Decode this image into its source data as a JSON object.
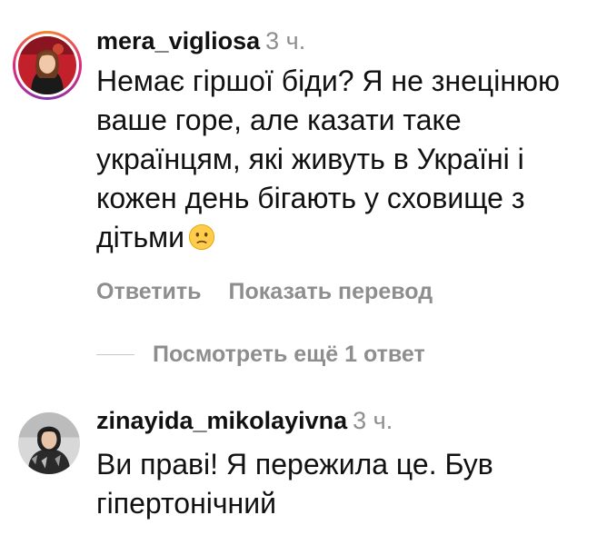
{
  "comments": [
    {
      "username": "mera_vigliosa",
      "time": "3 ч.",
      "text": "Немає гіршої біди? Я не знецінюю ваше горе, але казати таке українцям, які живуть в Україні і кожен день бігають у сховище з дітьми",
      "emoji": "confused-face-icon",
      "reply_label": "Ответить",
      "translate_label": "Показать перевод",
      "view_replies_label": "Посмотреть ещё 1 ответ",
      "has_story_ring": true
    },
    {
      "username": "zinayida_mikolayivna",
      "time": "3 ч.",
      "text": "Ви праві! Я пережила це. Був гіпертонічний",
      "has_story_ring": false
    }
  ],
  "colors": {
    "text": "#111111",
    "secondary": "#8e8e8e",
    "story_ring": "#dd2a7b",
    "emoji": "#ffcc4d"
  }
}
